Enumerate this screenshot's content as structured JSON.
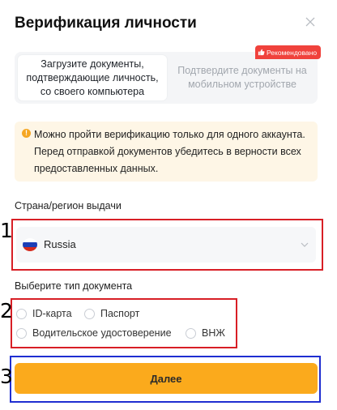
{
  "dialog": {
    "title": "Верификация личности",
    "close_icon": "close-icon"
  },
  "tabs": [
    {
      "label": "Загрузите документы, подтверждающие личность, со своего компьютера",
      "active": true
    },
    {
      "label": "Подтвердите документы на мобильном устройстве",
      "active": false
    }
  ],
  "badge": {
    "label": "Рекомендовано",
    "icon": "thumbs-up-icon",
    "color": "#f0423c"
  },
  "notice": {
    "icon": "warning-icon",
    "text": "Можно пройти верификацию только для одного аккаунта. Перед отправкой документов убедитесь в верности всех предоставленных данных."
  },
  "country": {
    "label": "Страна/регион выдачи",
    "value": "Russia",
    "flag_icon": "russia-flag-icon",
    "chevron_icon": "chevron-down-icon"
  },
  "document": {
    "label": "Выберите тип документа",
    "options": [
      "ID-карта",
      "Паспорт",
      "Водительское удостоверение",
      "ВНЖ"
    ]
  },
  "submit": {
    "label": "Далее",
    "color": "#fbaa1c"
  },
  "annotations": [
    {
      "number": "1",
      "color": "#d81f26"
    },
    {
      "number": "2",
      "color": "#d81f26"
    },
    {
      "number": "3",
      "color": "#1f2ed1"
    }
  ]
}
